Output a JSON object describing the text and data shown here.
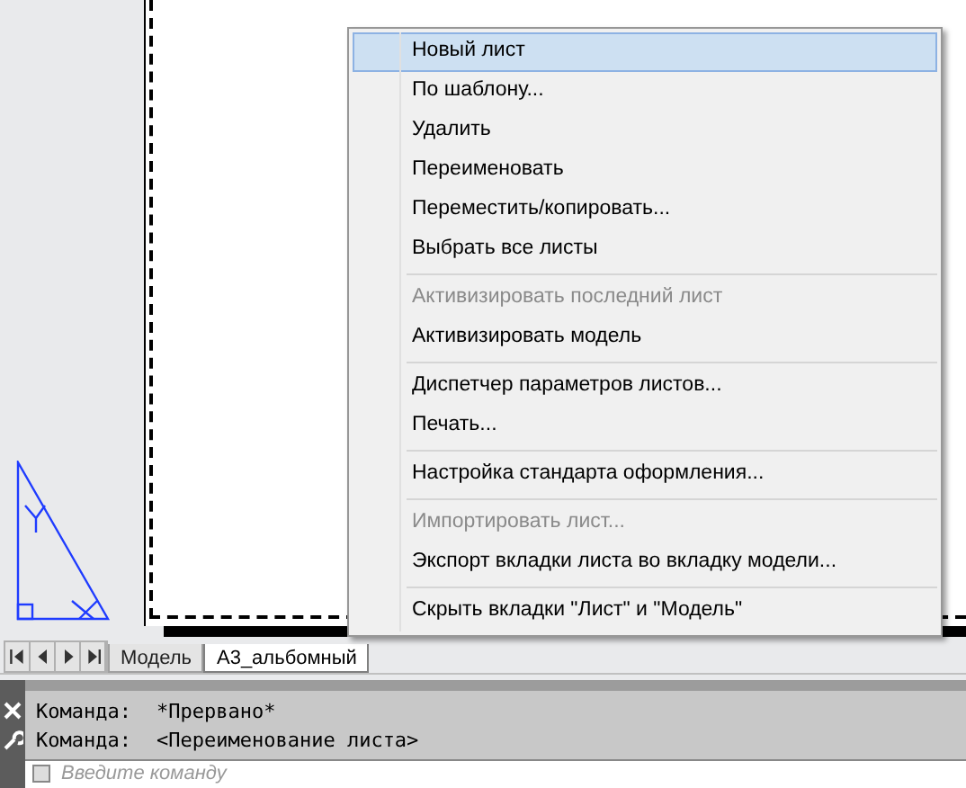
{
  "menu": {
    "items": [
      {
        "kind": "item",
        "label": "Новый лист",
        "selected": true,
        "disabled": false
      },
      {
        "kind": "item",
        "label": "По шаблону...",
        "selected": false,
        "disabled": false
      },
      {
        "kind": "item",
        "label": "Удалить",
        "selected": false,
        "disabled": false
      },
      {
        "kind": "item",
        "label": "Переименовать",
        "selected": false,
        "disabled": false
      },
      {
        "kind": "item",
        "label": "Переместить/копировать...",
        "selected": false,
        "disabled": false
      },
      {
        "kind": "item",
        "label": "Выбрать все листы",
        "selected": false,
        "disabled": false
      },
      {
        "kind": "separator"
      },
      {
        "kind": "item",
        "label": "Активизировать последний лист",
        "selected": false,
        "disabled": true
      },
      {
        "kind": "item",
        "label": "Активизировать модель",
        "selected": false,
        "disabled": false
      },
      {
        "kind": "separator"
      },
      {
        "kind": "item",
        "label": "Диспетчер параметров листов...",
        "selected": false,
        "disabled": false
      },
      {
        "kind": "item",
        "label": "Печать...",
        "selected": false,
        "disabled": false
      },
      {
        "kind": "separator"
      },
      {
        "kind": "item",
        "label": "Настройка стандарта оформления...",
        "selected": false,
        "disabled": false
      },
      {
        "kind": "separator"
      },
      {
        "kind": "item",
        "label": "Импортировать лист...",
        "selected": false,
        "disabled": true
      },
      {
        "kind": "item",
        "label": "Экспорт вкладки листа во вкладку модели...",
        "selected": false,
        "disabled": false
      },
      {
        "kind": "separator"
      },
      {
        "kind": "item",
        "label": "Скрыть вкладки \"Лист\" и \"Модель\"",
        "selected": false,
        "disabled": false
      }
    ]
  },
  "tabs": [
    {
      "label": "Модель",
      "selected": false
    },
    {
      "label": "А3_альбомный",
      "selected": true
    }
  ],
  "command_line": {
    "history": [
      {
        "prompt": "Команда:",
        "text": "*Прервано*"
      },
      {
        "prompt": "Команда:",
        "text": "<Переименование листа>"
      }
    ],
    "input": {
      "placeholder": "Введите команду"
    }
  }
}
